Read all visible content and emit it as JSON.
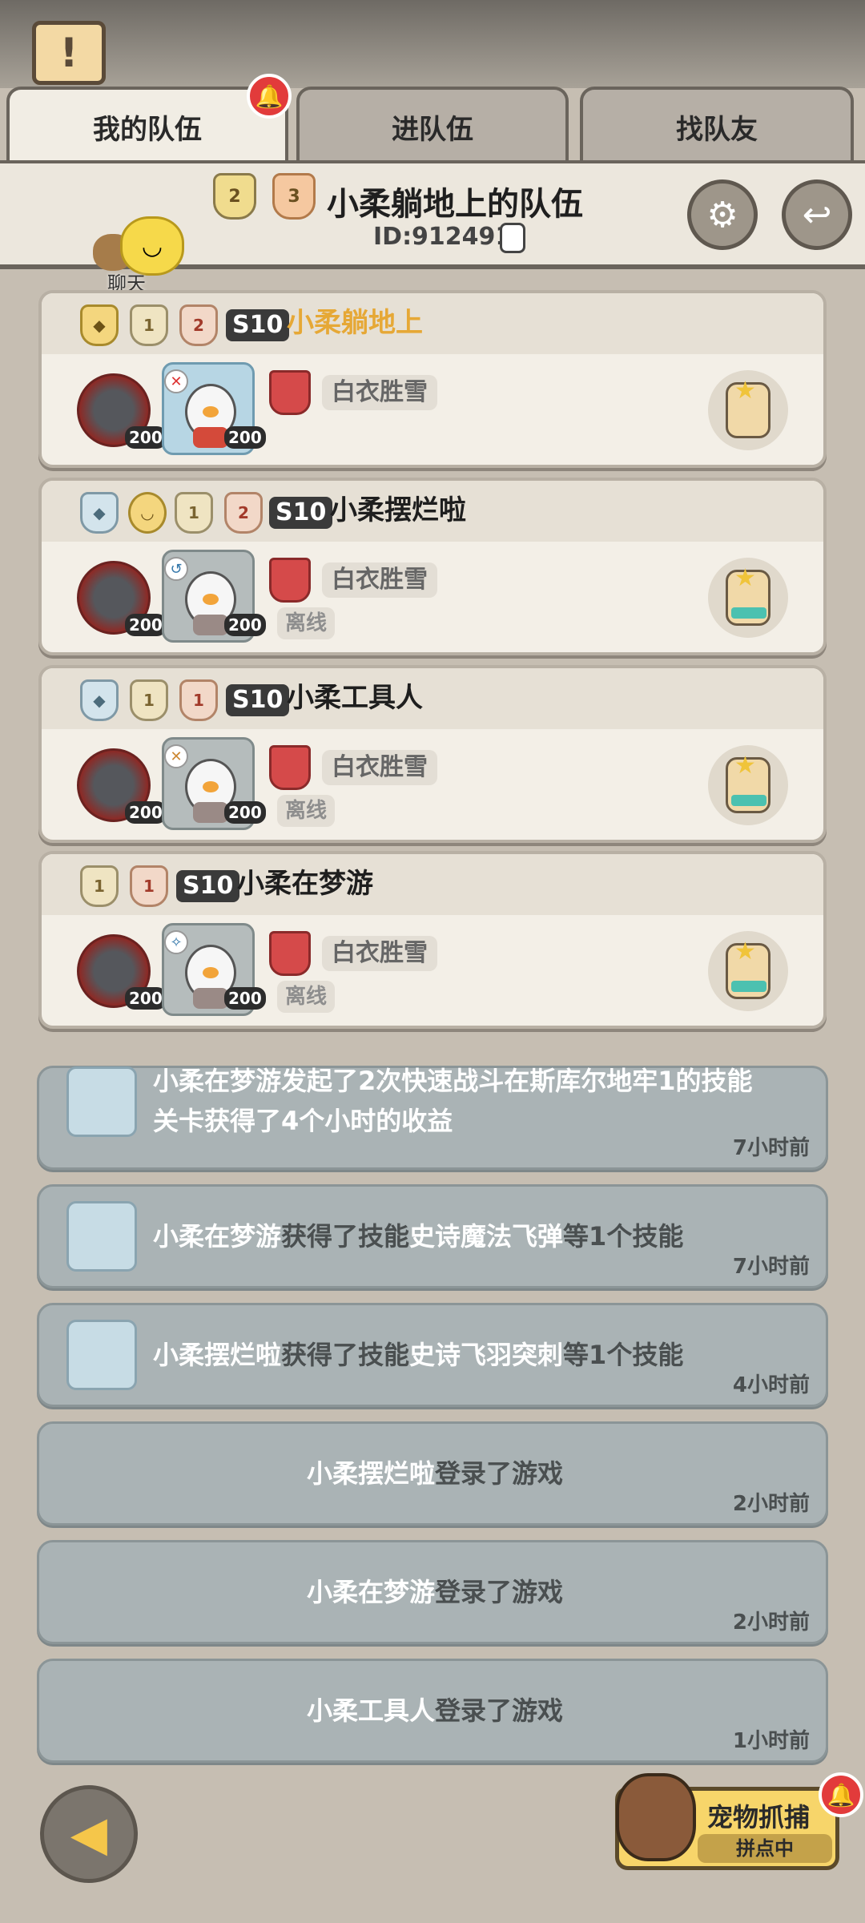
{
  "tabs": [
    {
      "label": "我的队伍",
      "active": true
    },
    {
      "label": "进队伍",
      "active": false
    },
    {
      "label": "找队友",
      "active": false
    }
  ],
  "header": {
    "team_name": "小柔躺地上的队伍",
    "team_id": "ID:912491",
    "badge_left": "2",
    "badge_right": "3",
    "chat_label": "聊天"
  },
  "members": [
    {
      "season": "S10",
      "name": "小柔躺地上",
      "leader": true,
      "pet_level": "200",
      "hero_level": "200",
      "title": "白衣胜雪",
      "status": ""
    },
    {
      "season": "S10",
      "name": "小柔摆烂啦",
      "leader": false,
      "pet_level": "200",
      "hero_level": "200",
      "title": "白衣胜雪",
      "status": "离线"
    },
    {
      "season": "S10",
      "name": "小柔工具人",
      "leader": false,
      "pet_level": "200",
      "hero_level": "200",
      "title": "白衣胜雪",
      "status": "离线"
    },
    {
      "season": "S10",
      "name": "小柔在梦游",
      "leader": false,
      "pet_level": "200",
      "hero_level": "200",
      "title": "白衣胜雪",
      "status": "离线"
    }
  ],
  "feed": [
    {
      "line1": "小柔在梦游发起了2次快速战斗在斯库尔地牢1的技能",
      "line2": "关卡获得了4个小时的收益",
      "time": "7小时前"
    },
    {
      "name": "小柔在梦游",
      "text": "获得了技能",
      "highlight": "史诗魔法飞弹",
      "suffix": "等1个技能",
      "time": "7小时前"
    },
    {
      "name": "小柔摆烂啦",
      "text": "获得了技能",
      "highlight": "史诗飞羽突刺",
      "suffix": "等1个技能",
      "time": "4小时前"
    },
    {
      "name": "小柔摆烂啦",
      "text": "登录了游戏",
      "time": "2小时前"
    },
    {
      "name": "小柔在梦游",
      "text": "登录了游戏",
      "time": "2小时前"
    },
    {
      "name": "小柔工具人",
      "text": "登录了游戏",
      "time": "1小时前"
    }
  ],
  "pet_catch": {
    "title": "宠物抓捕",
    "subtitle": "拼点中"
  },
  "colors": {
    "leader_name": "#e6a836",
    "feed_bg": "#aab3b5",
    "alert": "#e23b3b"
  }
}
